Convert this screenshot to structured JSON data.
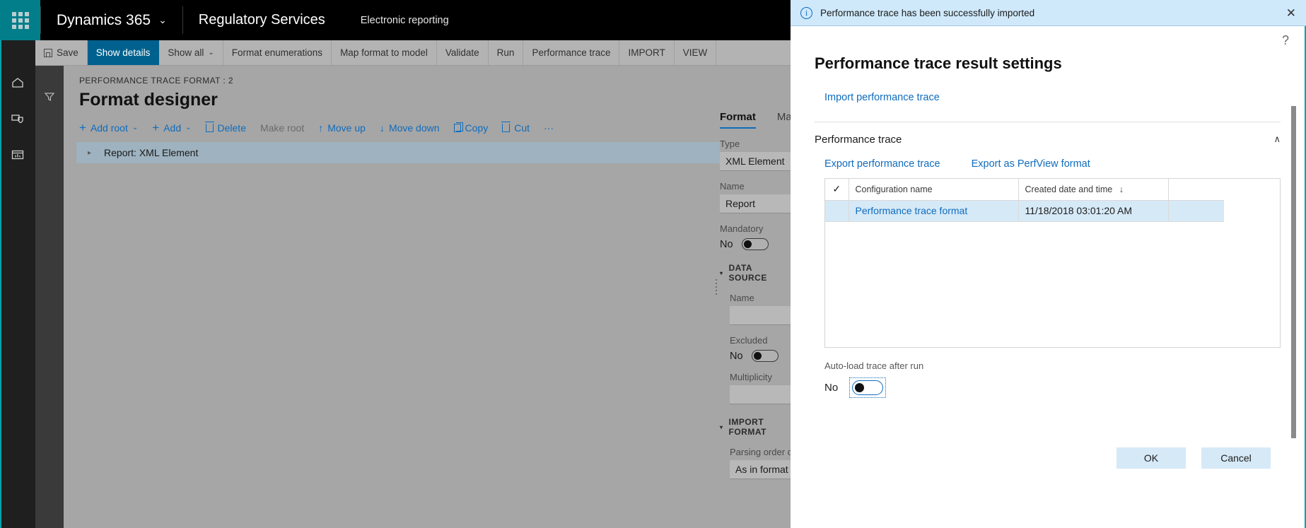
{
  "nav": {
    "waffle_icon": "waffle-grid-icon",
    "brand": "Dynamics 365",
    "brand_chevron": "⌄",
    "area": "Regulatory Services",
    "page": "Electronic reporting"
  },
  "toolbar": {
    "menu_icon": "hamburger-icon",
    "items": [
      {
        "label": "Save",
        "icon": "save-icon",
        "active": false
      },
      {
        "label": "Show details",
        "active": true
      },
      {
        "label": "Show all",
        "chevron": "⌄",
        "active": false
      },
      {
        "label": "Format enumerations",
        "active": false
      },
      {
        "label": "Map format to model",
        "active": false
      },
      {
        "label": "Validate",
        "active": false
      },
      {
        "label": "Run",
        "active": false
      },
      {
        "label": "Performance trace",
        "active": false
      },
      {
        "label": "IMPORT",
        "active": false
      },
      {
        "label": "VIEW",
        "active": false
      }
    ]
  },
  "rail": {
    "icons": [
      "home-icon",
      "workspace-shield-icon",
      "report-window-icon"
    ],
    "filter_icon": "filter-funnel-icon"
  },
  "designer": {
    "breadcrumb": "PERFORMANCE TRACE FORMAT : 2",
    "title": "Format designer",
    "actions": [
      {
        "label": "Add root",
        "icon": "plus-icon",
        "chevron": "⌄",
        "dim": false
      },
      {
        "label": "Add",
        "icon": "plus-icon",
        "chevron": "⌄",
        "dim": false
      },
      {
        "label": "Delete",
        "icon": "trash-icon",
        "dim": false
      },
      {
        "label": "Make root",
        "dim": true
      },
      {
        "label": "Move up",
        "icon": "arrow-up-icon",
        "dim": false
      },
      {
        "label": "Move down",
        "icon": "arrow-down-icon",
        "dim": false
      },
      {
        "label": "Copy",
        "icon": "copy-icon",
        "dim": false
      },
      {
        "label": "Cut",
        "icon": "cut-icon",
        "dim": false
      },
      {
        "label": "···",
        "dim": false
      }
    ],
    "tree": {
      "expand_arrow": "▸",
      "root_label": "Report: XML Element"
    }
  },
  "properties": {
    "tabs": [
      {
        "label": "Format",
        "selected": true
      },
      {
        "label": "Mapping",
        "selected": false
      }
    ],
    "type_label": "Type",
    "type_value": "XML Element",
    "name_label": "Name",
    "name_value": "Report",
    "mandatory_label": "Mandatory",
    "mandatory_value": "No",
    "data_source": {
      "heading": "DATA SOURCE",
      "name_label": "Name",
      "name_value": "",
      "excluded_label": "Excluded",
      "excluded_value": "No",
      "multiplicity_label": "Multiplicity",
      "multiplicity_value": ""
    },
    "import_format": {
      "heading": "IMPORT FORMAT",
      "parsing_label": "Parsing order of nest",
      "parsing_value": "As in format"
    }
  },
  "notification": {
    "icon": "info-icon",
    "message": "Performance trace has been successfully imported",
    "close_icon": "✕"
  },
  "dialog": {
    "help_icon": "?",
    "title": "Performance trace result settings",
    "import_link": "Import performance trace",
    "section": {
      "title": "Performance trace",
      "collapse_chevron": "∧",
      "links": [
        "Export performance trace",
        "Export as PerfView format"
      ]
    },
    "grid": {
      "check_icon": "✓",
      "columns": [
        "Configuration name",
        "Created date and time"
      ],
      "sort_arrow": "↓",
      "sorted_column": "Created date and time",
      "rows": [
        {
          "configuration_name": "Performance trace format",
          "created_date_and_time": "11/18/2018 03:01:20 AM",
          "selected": true
        }
      ]
    },
    "autoload": {
      "label": "Auto-load trace after run",
      "value": "No"
    },
    "buttons": {
      "ok": "OK",
      "cancel": "Cancel"
    }
  },
  "colors": {
    "brand_teal": "#017e8a",
    "accent_blue": "#0f6cbd",
    "active_tab_blue": "#00618f",
    "notification_bg": "#cfe9fb",
    "row_selected_bg": "#d6e9f7",
    "edge_teal": "#00a3ad"
  }
}
